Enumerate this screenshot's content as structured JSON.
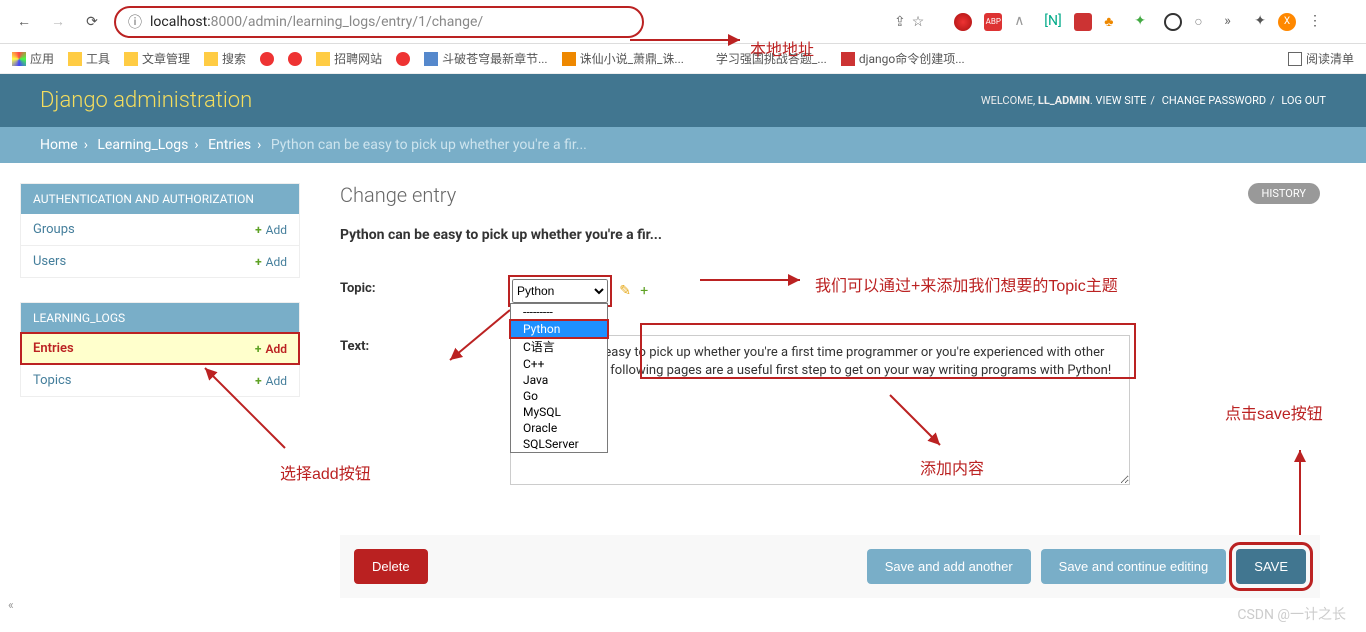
{
  "browser": {
    "url_host": "localhost:",
    "url_port_path": "8000/admin/learning_logs/entry/1/change/",
    "bookmarks": [
      "应用",
      "工具",
      "文章管理",
      "搜索",
      "",
      "",
      "",
      "招聘网站",
      "",
      "斗破苍穹最新章节...",
      "",
      "诛仙小说_萧鼎_诛...",
      "",
      "学习强国挑战答题_...",
      "",
      "django命令创建项..."
    ],
    "read_list": "阅读清单"
  },
  "header": {
    "title": "Django administration",
    "welcome": "WELCOME, ",
    "user": "LL_ADMIN",
    "links": {
      "view_site": "VIEW SITE",
      "change_pw": "CHANGE PASSWORD",
      "logout": "LOG OUT"
    }
  },
  "breadcrumb": {
    "home": "Home",
    "app": "Learning_Logs",
    "model": "Entries",
    "current": "Python can be easy to pick up whether you're a fir..."
  },
  "sidebar": {
    "auth_title": "AUTHENTICATION AND AUTHORIZATION",
    "auth_items": [
      {
        "name": "Groups",
        "add": "Add"
      },
      {
        "name": "Users",
        "add": "Add"
      }
    ],
    "app_title": "LEARNING_LOGS",
    "app_items": [
      {
        "name": "Entries",
        "add": "Add",
        "highlight": true
      },
      {
        "name": "Topics",
        "add": "Add",
        "highlight": false
      }
    ]
  },
  "content": {
    "page_title": "Change entry",
    "history": "HISTORY",
    "obj_title": "Python can be easy to pick up whether you're a fir...",
    "topic_label": "Topic:",
    "topic_value": "Python",
    "topic_options": [
      "---------",
      "Python",
      "C语言",
      "C++",
      "Java",
      "Go",
      "MySQL",
      "Oracle",
      "SQLServer"
    ],
    "text_label": "Text:",
    "text_value": "Python can be easy to pick up whether you're a first time programmer or you're experienced with other languages. The following pages are a useful first step to get on your way writing programs with Python!",
    "buttons": {
      "delete": "Delete",
      "save_add": "Save and add another",
      "save_cont": "Save and continue editing",
      "save": "SAVE"
    }
  },
  "annotations": {
    "url": "本地地址",
    "topic_hint": "我们可以通过+来添加我们想要的Topic主题",
    "add_hint": "选择add按钮",
    "text_hint": "添加内容",
    "save_hint": "点击save按钮"
  },
  "watermark": "CSDN @一计之长"
}
